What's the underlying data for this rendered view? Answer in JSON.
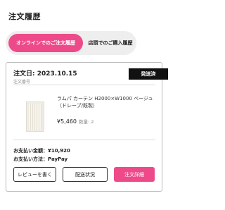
{
  "page": {
    "title": "注文履歴"
  },
  "tabs": [
    {
      "label": "オンラインでのご注文履歴",
      "active": true
    },
    {
      "label": "店頭でのご購入履歴",
      "active": false
    }
  ],
  "order": {
    "date_label": "注文日: 2023.10.15",
    "sub_label": "注文番号",
    "status": "発送済",
    "product": {
      "name": "ラムパ カーテン H2000×W1000 ベージュ（ドレープ/既製）",
      "price": "¥5,460",
      "quantity_label": "数量: 2"
    },
    "payment_amount": "お支払い金額：¥10,920",
    "payment_method": "お支払い方法：PayPay"
  },
  "buttons": {
    "review": "レビューを書く",
    "shipping": "配送状況",
    "detail": "注文詳細"
  },
  "colors": {
    "accent": "#ee4a8a",
    "badge": "#111111"
  }
}
